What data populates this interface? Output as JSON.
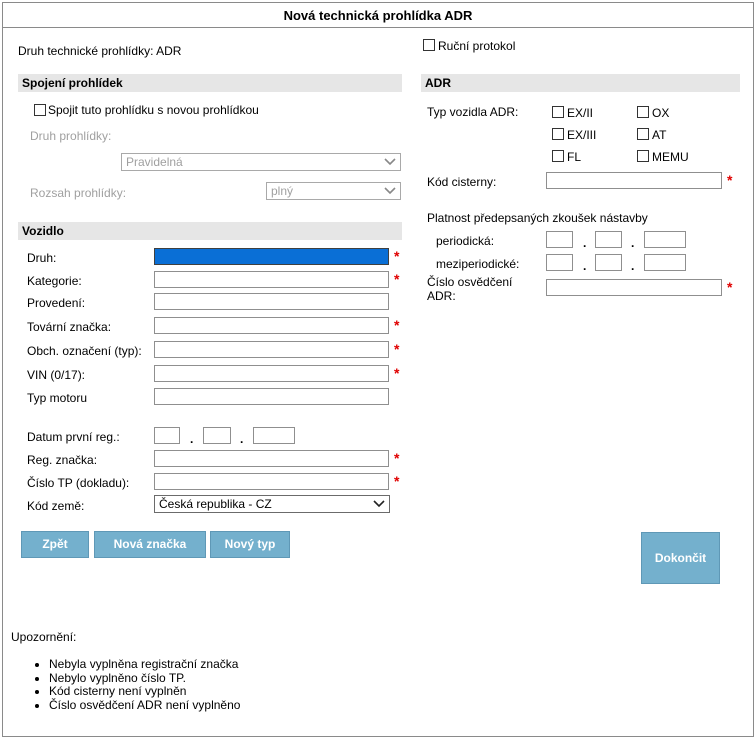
{
  "window": {
    "title": "Nová technická prohlídka ADR"
  },
  "header": {
    "inspection_type_label": "Druh technické prohlídky: ADR",
    "manual_protocol_label": "Ruční protokol"
  },
  "link_section": {
    "heading": "Spojení prohlídek",
    "link_checkbox_label": "Spojit tuto prohlídku s novou prohlídkou",
    "inspection_kind_label": "Druh prohlídky:",
    "inspection_kind_value": "Pravidelná",
    "inspection_scope_label": "Rozsah prohlídky:",
    "inspection_scope_value": "plný"
  },
  "vehicle": {
    "heading": "Vozidlo",
    "fields": {
      "druh": "Druh:",
      "kategorie": "Kategorie:",
      "provedeni": "Provedení:",
      "tovarni_znacka": "Tovární značka:",
      "obch_oznaceni": "Obch. označení (typ):",
      "vin": "VIN (0/17):",
      "typ_motoru": "Typ motoru",
      "datum_prvni_reg": "Datum první reg.:",
      "reg_znacka": "Reg. značka:",
      "cislo_tp": "Číslo TP (dokladu):",
      "kod_zeme": "Kód země:"
    },
    "country_value": "Česká republika - CZ",
    "date_separator": "."
  },
  "adr": {
    "heading": "ADR",
    "vehicle_type_label": "Typ vozidla ADR:",
    "types": [
      "EX/II",
      "OX",
      "EX/III",
      "AT",
      "FL",
      "MEMU"
    ],
    "tank_code_label": "Kód cisterny:",
    "validity_label": "Platnost předepsaných zkoušek nástavby",
    "periodic_label": "periodická:",
    "interperiodic_label": "meziperiodické:",
    "cert_label_line1": "Číslo osvědčení",
    "cert_label_line2": "ADR:"
  },
  "required_marker": "*",
  "buttons": {
    "back": "Zpět",
    "new_brand": "Nová značka",
    "new_type": "Nový typ",
    "finish": "Dokončit"
  },
  "warnings": {
    "title": "Upozornění:",
    "items": [
      "Nebyla vyplněna registrační značka",
      "Nebylo vyplněno číslo TP.",
      "Kód cisterny není vyplněn",
      "Číslo osvědčení ADR není vyplněno"
    ]
  }
}
